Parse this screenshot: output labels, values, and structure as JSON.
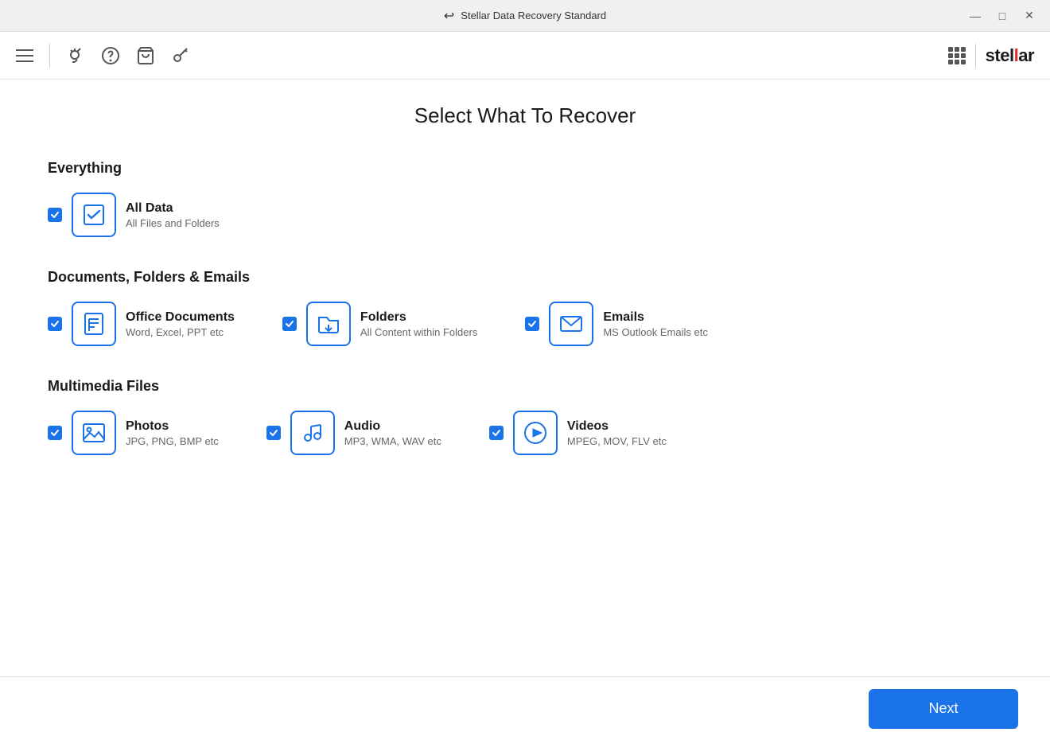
{
  "window": {
    "title": "Stellar Data Recovery Standard",
    "back_icon": "↩",
    "controls": {
      "minimize": "—",
      "maximize": "□",
      "close": "✕"
    }
  },
  "toolbar": {
    "menu_icon": "menu",
    "diagnostic_icon": "diagnostic",
    "help_icon": "help",
    "cart_icon": "cart",
    "key_icon": "key"
  },
  "page": {
    "title": "Select What To Recover"
  },
  "sections": {
    "everything": {
      "title": "Everything",
      "items": [
        {
          "id": "all-data",
          "label": "All Data",
          "description": "All Files and Folders",
          "checked": true
        }
      ]
    },
    "documents": {
      "title": "Documents, Folders & Emails",
      "items": [
        {
          "id": "office-docs",
          "label": "Office Documents",
          "description": "Word, Excel, PPT etc",
          "checked": true
        },
        {
          "id": "folders",
          "label": "Folders",
          "description": "All Content within Folders",
          "checked": true
        },
        {
          "id": "emails",
          "label": "Emails",
          "description": "MS Outlook Emails etc",
          "checked": true
        }
      ]
    },
    "multimedia": {
      "title": "Multimedia Files",
      "items": [
        {
          "id": "photos",
          "label": "Photos",
          "description": "JPG, PNG, BMP etc",
          "checked": true
        },
        {
          "id": "audio",
          "label": "Audio",
          "description": "MP3, WMA, WAV etc",
          "checked": true
        },
        {
          "id": "videos",
          "label": "Videos",
          "description": "MPEG, MOV, FLV etc",
          "checked": true
        }
      ]
    }
  },
  "footer": {
    "next_button": "Next"
  }
}
